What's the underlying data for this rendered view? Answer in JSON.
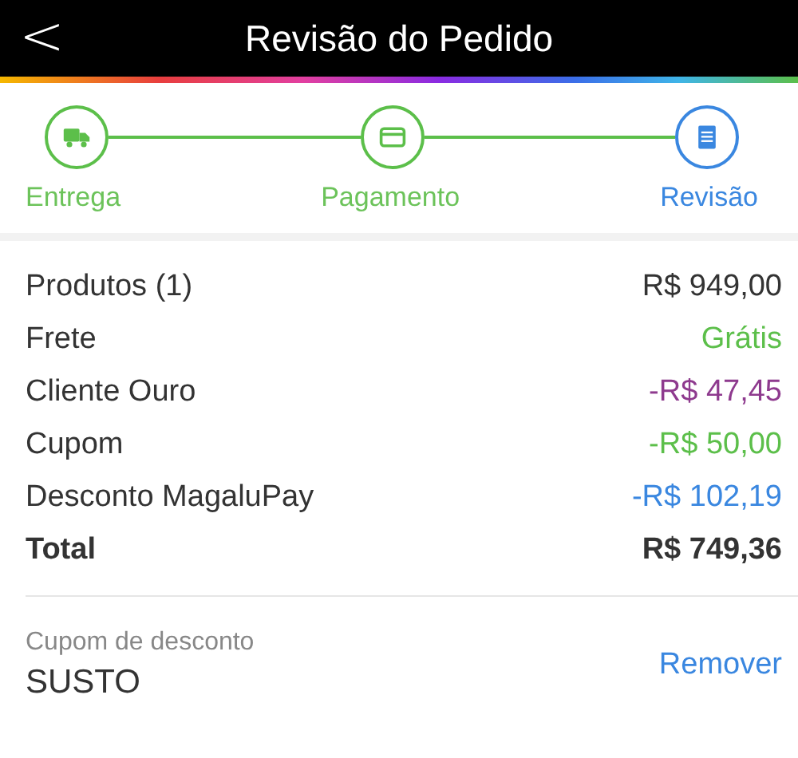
{
  "header": {
    "back": "<",
    "title": "Revisão do Pedido"
  },
  "steps": [
    {
      "kind": "truck",
      "label": "Entrega",
      "selected": false
    },
    {
      "kind": "card",
      "label": "Pagamento",
      "selected": false
    },
    {
      "kind": "document",
      "label": "Revisão",
      "selected": true
    }
  ],
  "summary": [
    {
      "kind": "line",
      "label": "Produtos (1)",
      "value": "R$ 949,00",
      "color": "#333333"
    },
    {
      "kind": "line",
      "label": "Frete",
      "value": "Grátis",
      "color": "#5cbf4a"
    },
    {
      "kind": "line",
      "label": "Cliente Ouro",
      "value": "-R$ 47,45",
      "color": "#8e3a8e"
    },
    {
      "kind": "line",
      "label": "Cupom",
      "value": "-R$ 50,00",
      "color": "#5cbf4a"
    },
    {
      "kind": "line",
      "label": "Desconto MagaluPay",
      "value": "-R$ 102,19",
      "color": "#3a87e0"
    },
    {
      "kind": "total",
      "label": "Total",
      "value": "R$ 749,36",
      "color": "#333333"
    }
  ],
  "coupon": {
    "label": "Cupom de desconto",
    "code": "SUSTO",
    "action": "Remover"
  }
}
